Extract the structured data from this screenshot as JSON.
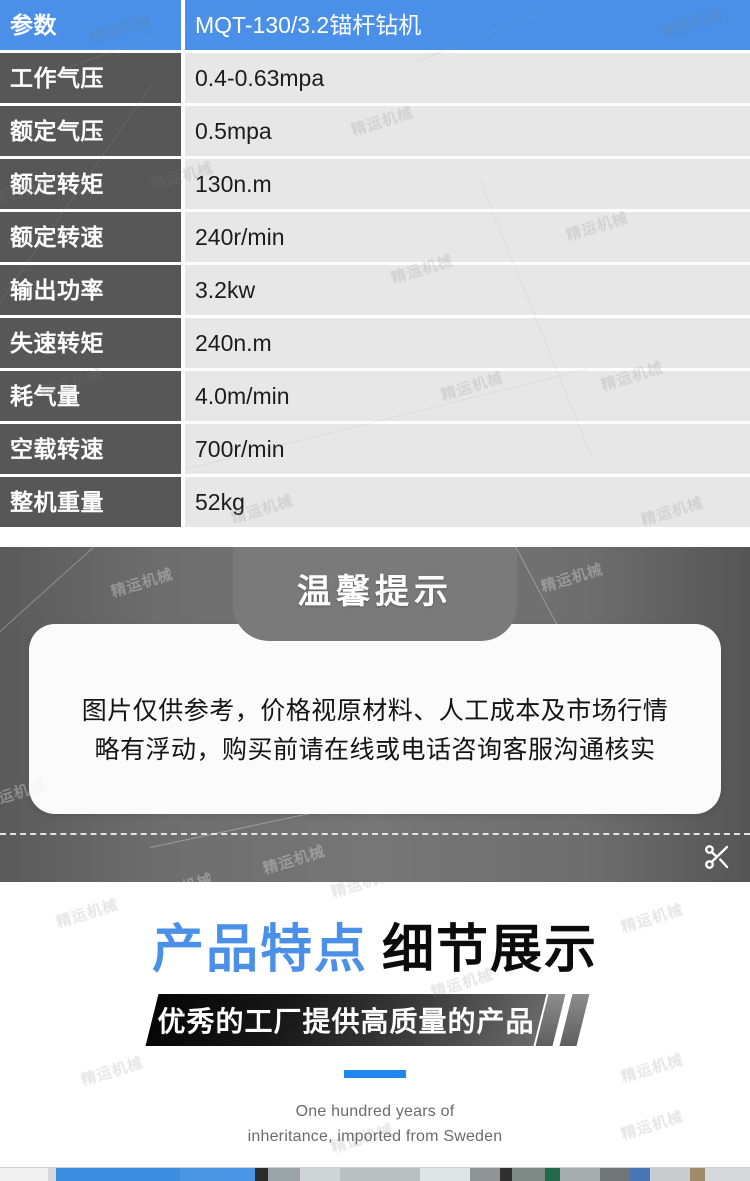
{
  "spec_table": {
    "header": {
      "key": "参数",
      "value": "MQT-130/3.2锚杆钻机"
    },
    "rows": [
      {
        "key": "工作气压",
        "value": "0.4-0.63mpa"
      },
      {
        "key": "额定气压",
        "value": "0.5mpa"
      },
      {
        "key": "额定转矩",
        "value": "130n.m"
      },
      {
        "key": "额定转速",
        "value": "240r/min"
      },
      {
        "key": "输出功率",
        "value": "3.2kw"
      },
      {
        "key": "失速转矩",
        "value": "240n.m"
      },
      {
        "key": "耗气量",
        "value": "4.0m/min"
      },
      {
        "key": "空载转速",
        "value": "700r/min"
      },
      {
        "key": "整机重量",
        "value": "52kg"
      }
    ]
  },
  "notice": {
    "tab_title": "温馨提示",
    "line1": "图片仅供参考，价格视原材料、人工成本及市场行情",
    "line2": "略有浮动，购买前请在线或电话咨询客服沟通核实",
    "scissors_icon": "scissors-icon"
  },
  "features": {
    "title_blue": "产品特点",
    "title_black": "细节展示",
    "banner_text": "优秀的工厂提供高质量的产品",
    "english_line1": "One hundred years of",
    "english_line2": "inheritance, imported from Sweden"
  },
  "watermark": {
    "text": "精运机械"
  },
  "colors": {
    "accent_blue": "#4a90e8",
    "divider_blue": "#1e88f0",
    "key_cell_gray": "#575757",
    "value_cell_gray": "#e7e7e7",
    "section_gray": "#767676"
  }
}
